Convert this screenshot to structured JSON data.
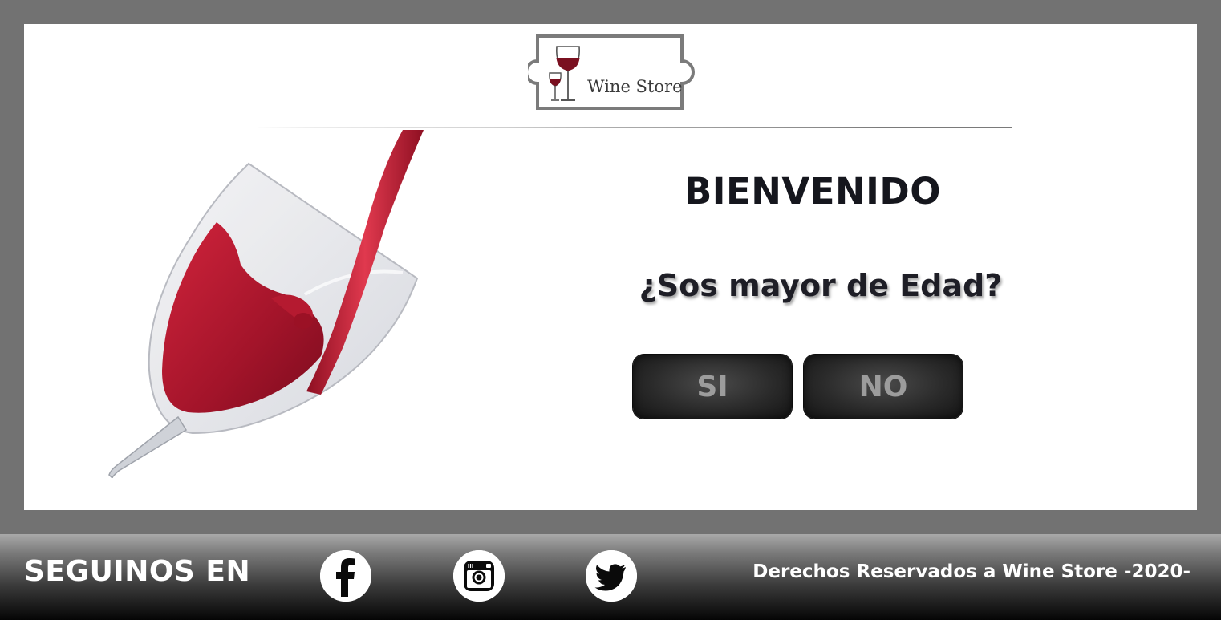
{
  "brand": {
    "name": "Wine Store"
  },
  "welcome": {
    "title": "BIENVENIDO",
    "question": "¿Sos mayor de Edad?",
    "yes_label": "SI",
    "no_label": "NO"
  },
  "footer": {
    "follow_label": "SEGUINOS EN",
    "social": [
      {
        "icon": "facebook-icon"
      },
      {
        "icon": "instagram-icon"
      },
      {
        "icon": "twitter-icon"
      }
    ],
    "copyright": "Derechos Reservados a Wine Store -2020-"
  },
  "colors": {
    "background_gray": "#727272",
    "panel": "#ffffff",
    "wine_red": "#b0182b",
    "button_dark": "#222222",
    "button_text": "#9c9c9c"
  }
}
